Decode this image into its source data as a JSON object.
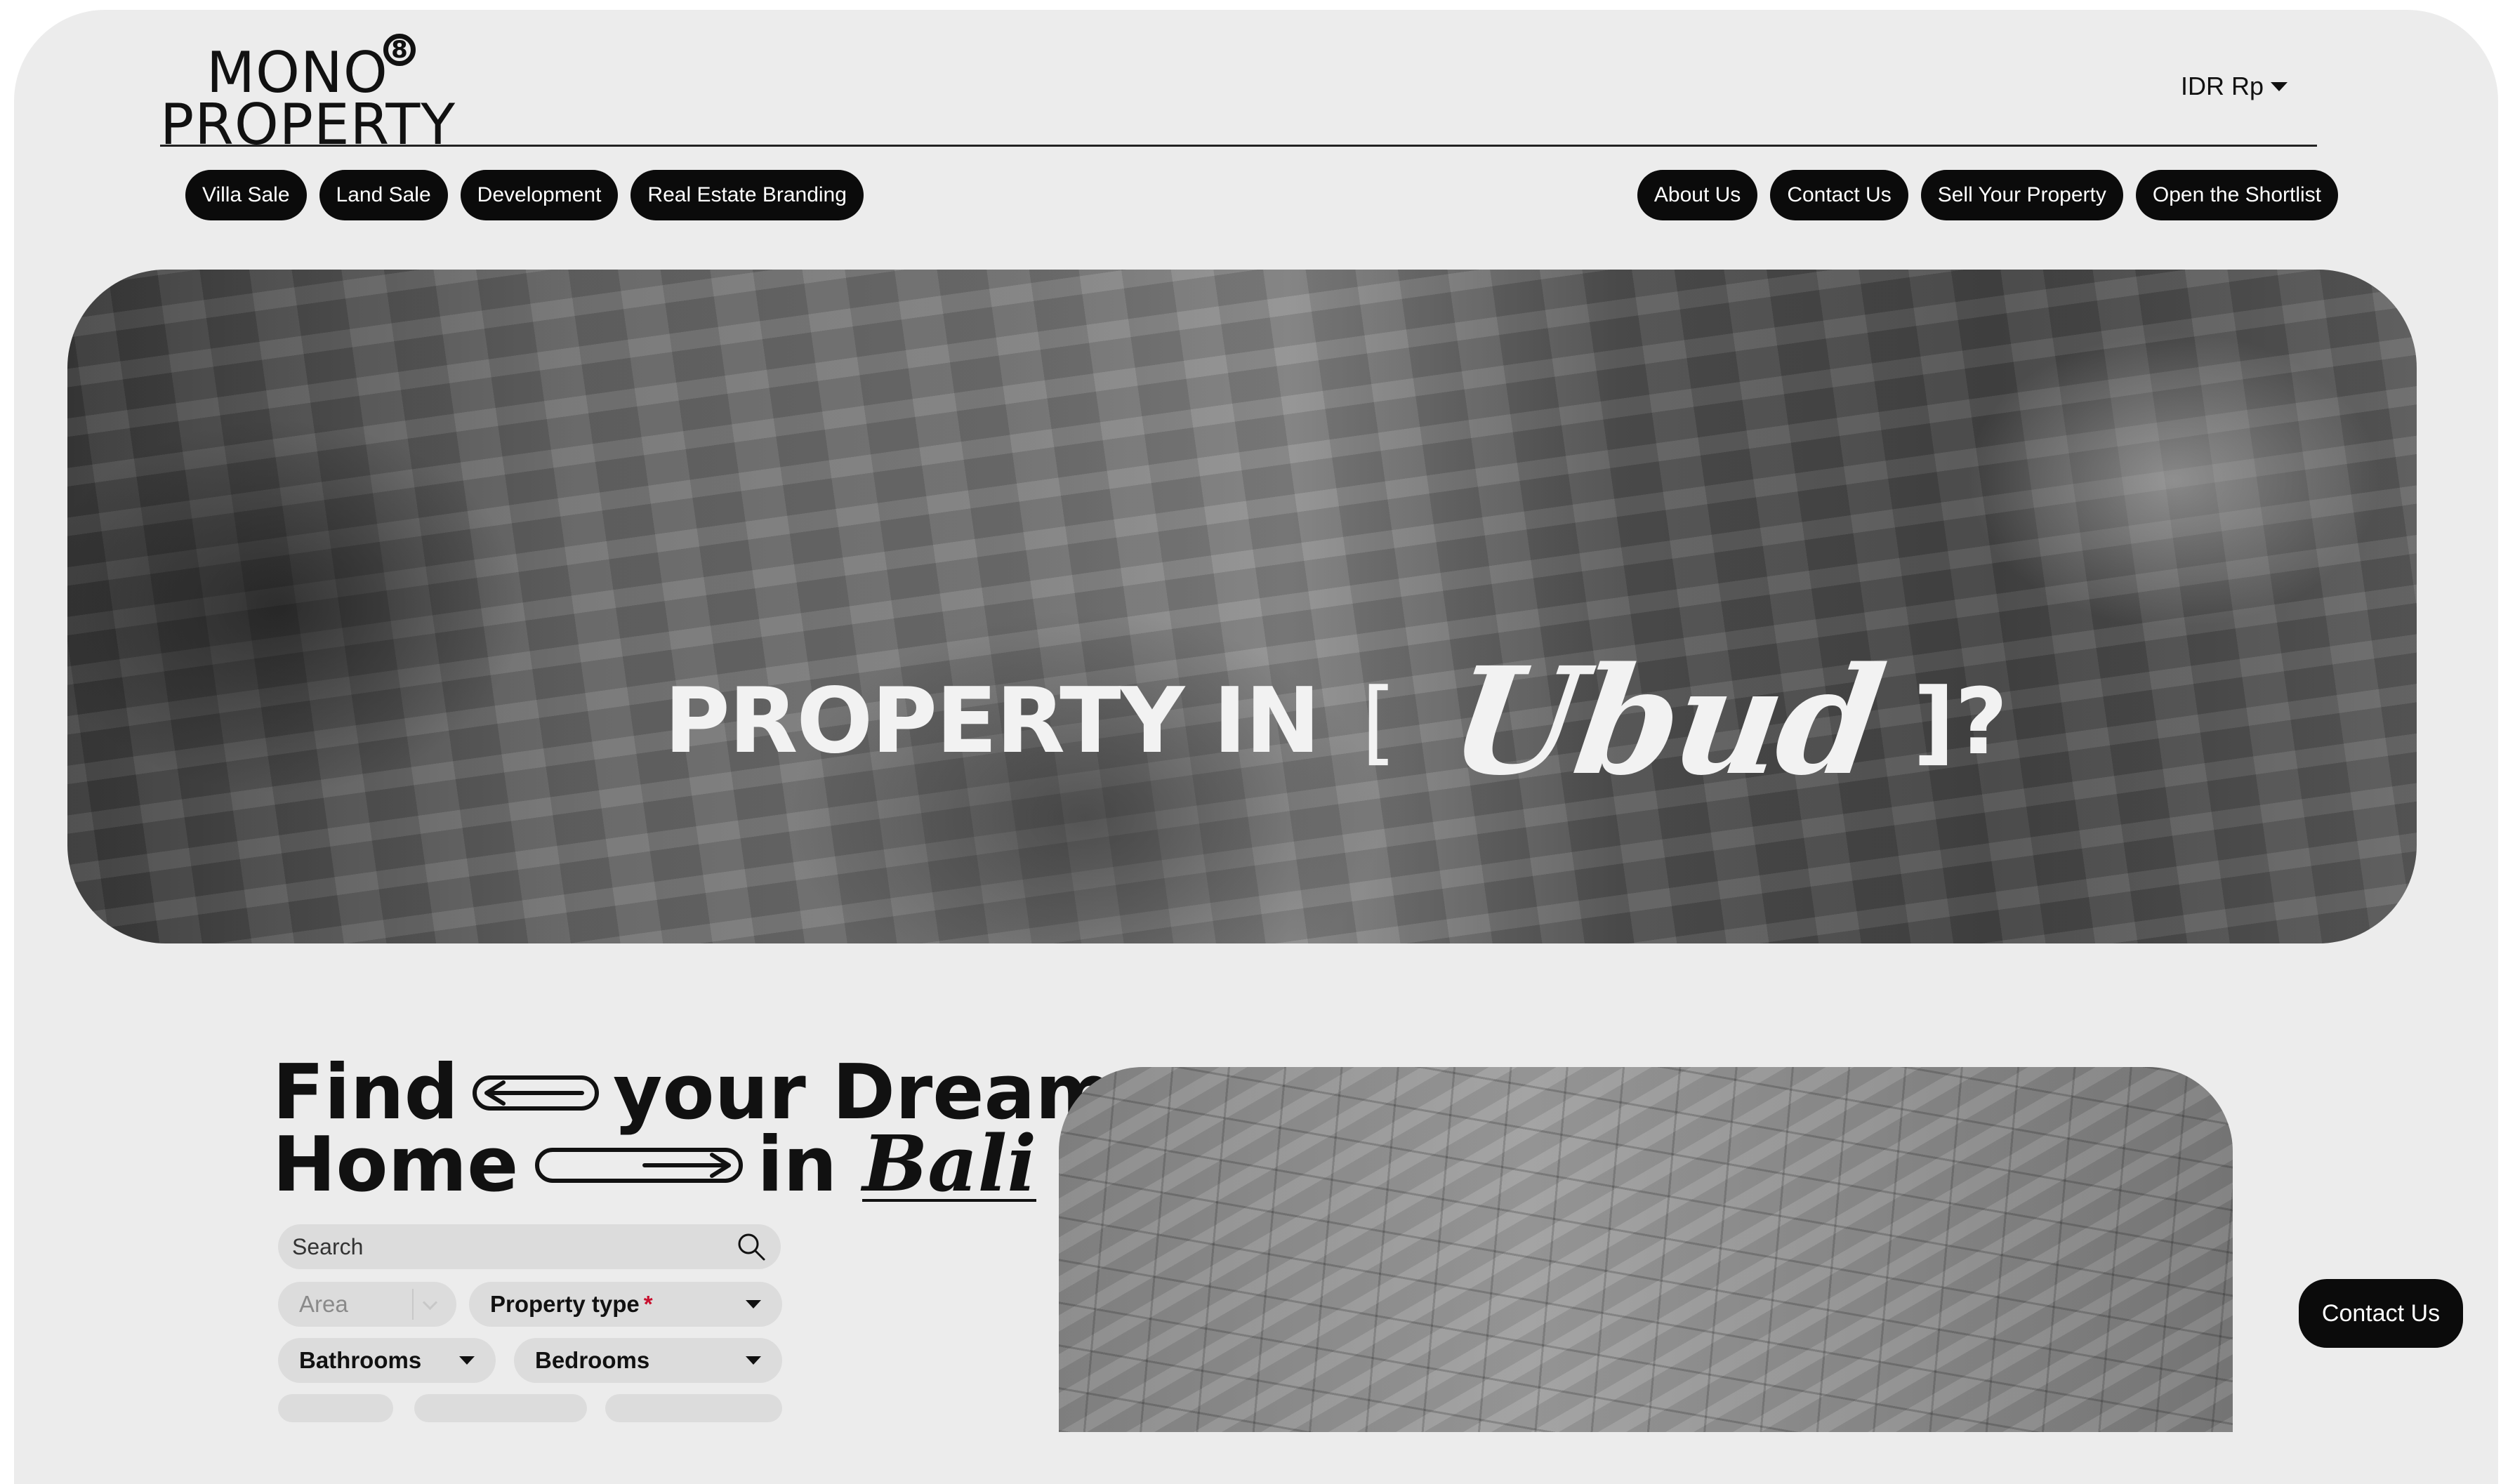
{
  "header": {
    "logo_line1": "MONO",
    "logo_badge": "8",
    "logo_line2": "PROPERTY",
    "currency": "IDR Rp"
  },
  "nav_left": [
    "Villa Sale",
    "Land Sale",
    "Development",
    "Real Estate Branding"
  ],
  "nav_right": [
    "About Us",
    "Contact Us",
    "Sell Your Property",
    "Open the Shortlist"
  ],
  "hero": {
    "prefix": "PROPERTY IN",
    "open_bracket": "[",
    "location": "Ubud",
    "close": "]?"
  },
  "find": {
    "line1_a": "Find",
    "line1_b": "your Dream",
    "line2_a": "Home",
    "line2_b": "in",
    "line2_script": "Bali"
  },
  "search": {
    "placeholder": "Search",
    "area_placeholder": "Area",
    "property_type": "Property type",
    "property_type_required": "*",
    "bathrooms": "Bathrooms",
    "bedrooms": "Bedrooms"
  },
  "floating": {
    "contact_label": "Contact Us"
  },
  "colors": {
    "accent": "#0b0b0b",
    "page_bg": "#ececec",
    "required": "#c8102e"
  }
}
